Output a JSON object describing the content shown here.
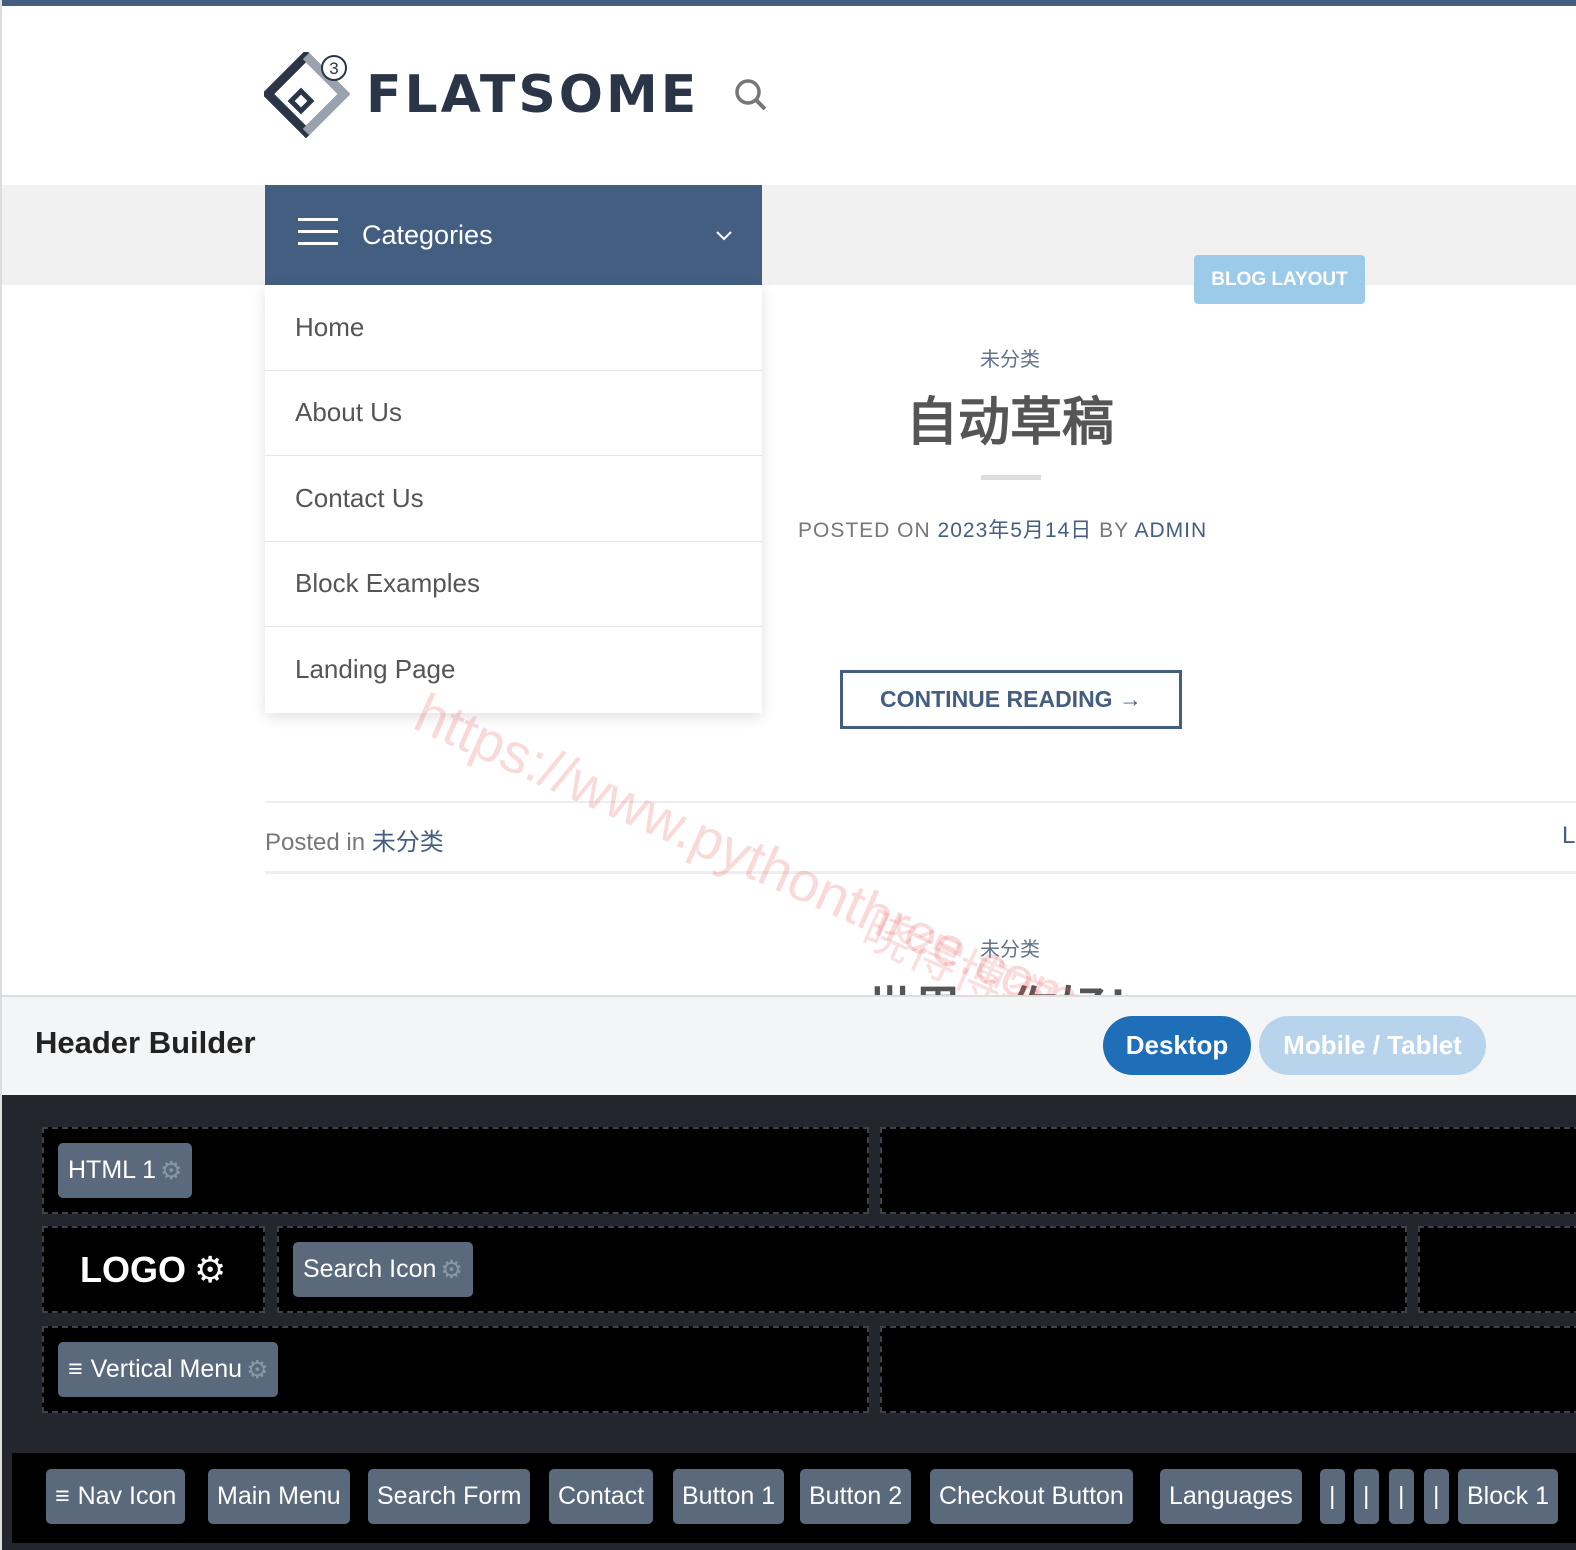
{
  "site": {
    "logo_text": "FLATSOME",
    "logo_badge": "3"
  },
  "categories": {
    "label": "Categories",
    "items": [
      "Home",
      "About Us",
      "Contact Us",
      "Block Examples",
      "Landing Page"
    ]
  },
  "badge": "BLOG LAYOUT",
  "post1": {
    "category": "未分类",
    "title": "自动草稿",
    "meta_prefix": "POSTED ON ",
    "date": "2023年5月14日",
    "meta_by": " BY ",
    "author": "ADMIN",
    "continue": "CONTINUE READING →"
  },
  "footer": {
    "posted_in": "Posted in ",
    "category": "未分类",
    "right": "L"
  },
  "post2": {
    "category": "未分类",
    "title": "世界，你好！"
  },
  "watermark": {
    "url": "https://www.pythonthree.com",
    "name": "晓得博客"
  },
  "builder": {
    "title": "Header Builder",
    "desktop": "Desktop",
    "mobile": "Mobile / Tablet",
    "top_chip": "HTML 1",
    "logo": "LOGO",
    "search_chip": "Search Icon",
    "bottom_chip": "Vertical Menu",
    "tray": [
      "Nav Icon",
      "Main Menu",
      "Search Form",
      "Contact",
      "Button 1",
      "Button 2",
      "Checkout Button",
      "Languages",
      "|",
      "|",
      "|",
      "|",
      "Block 1"
    ]
  },
  "colors": {
    "primary": "#445e82",
    "badge": "#9ccbea",
    "desktop": "#1e6eb8",
    "chip": "#5a6a7c"
  }
}
